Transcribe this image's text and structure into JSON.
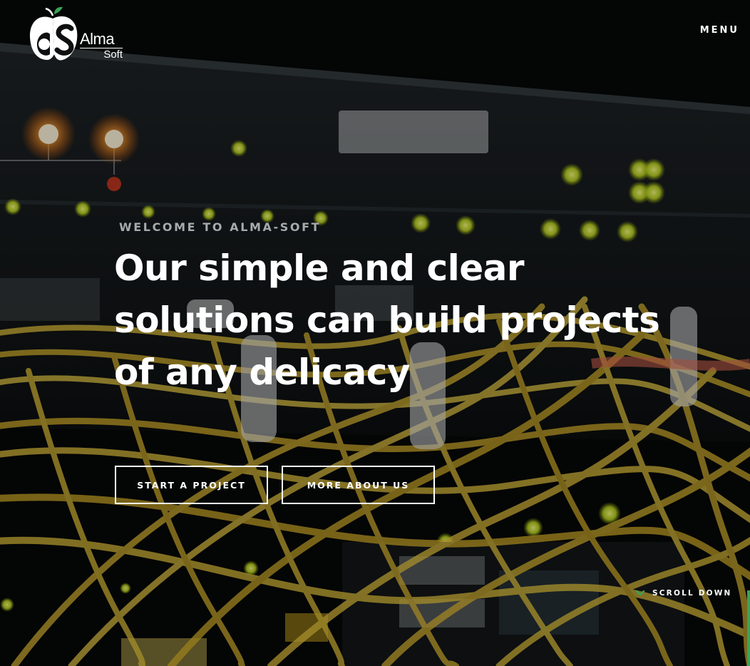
{
  "brand": {
    "logo_line1": "Alma",
    "logo_line2": "Soft",
    "leaf_color": "#3aa357"
  },
  "nav": {
    "menu_label": "MENU"
  },
  "hero": {
    "eyebrow": "WELCOME TO ALMA-SOFT",
    "headline_lines": [
      "Our simple and clear",
      "solutions can build projects",
      "of any delicacy"
    ],
    "buttons": {
      "start": "START A PROJECT",
      "more": "MORE ABOUT US"
    },
    "scroll_label": "SCROLL DOWN",
    "scroll_icon": "chevron-down-icon",
    "accent_color": "#3aa357",
    "background_image": "server rack with yellow fiber optic cables"
  }
}
